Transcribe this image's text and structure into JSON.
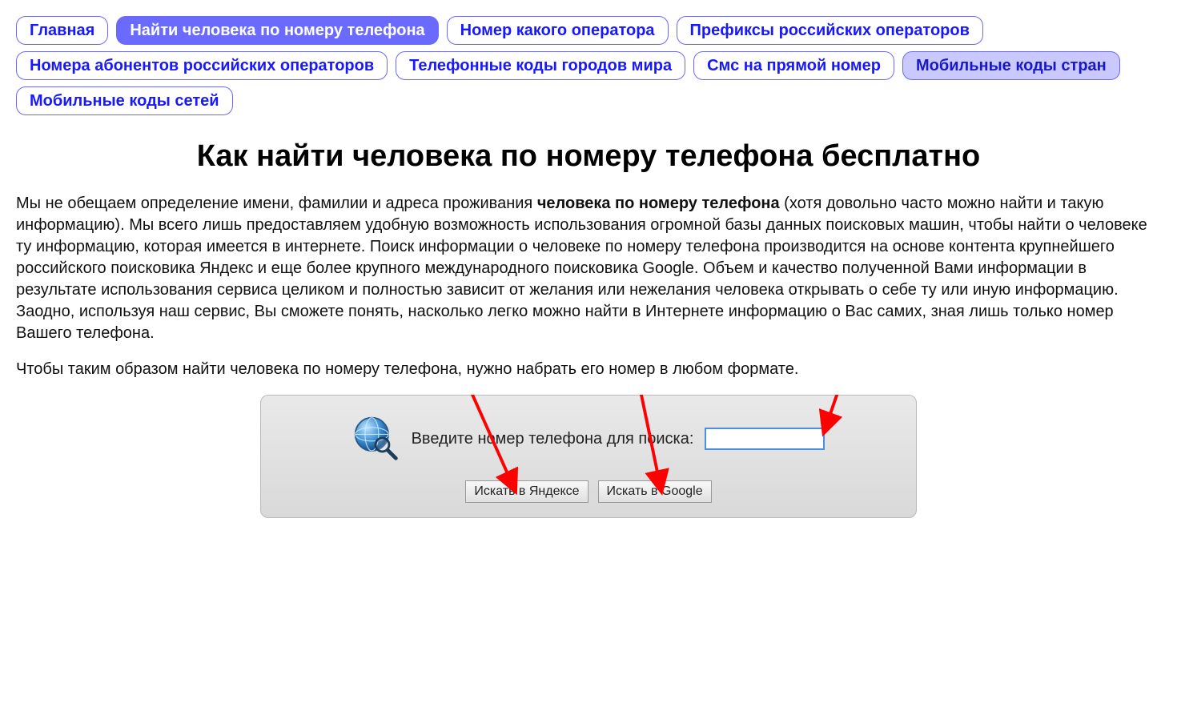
{
  "nav": {
    "items": [
      {
        "label": "Главная",
        "variant": "normal"
      },
      {
        "label": "Найти человека по номеру телефона",
        "variant": "active"
      },
      {
        "label": "Номер какого оператора",
        "variant": "normal"
      },
      {
        "label": "Префиксы российских операторов",
        "variant": "normal"
      },
      {
        "label": "Номера абонентов российских операторов",
        "variant": "normal"
      },
      {
        "label": "Телефонные коды городов мира",
        "variant": "normal"
      },
      {
        "label": "Смс на прямой номер",
        "variant": "normal"
      },
      {
        "label": "Мобильные коды стран",
        "variant": "alt"
      },
      {
        "label": "Мобильные коды сетей",
        "variant": "normal"
      }
    ]
  },
  "page": {
    "title": "Как найти человека по номеру телефона бесплатно",
    "para1_pre": "Мы не обещаем определение имени, фамилии и адреса проживания ",
    "para1_bold": "человека по номеру телефона",
    "para1_post": " (хотя довольно часто можно найти и такую информацию). Мы всего лишь предоставляем удобную возможность использования огромной базы данных поисковых машин, чтобы найти о человеке ту информацию, которая имеется в интернете. Поиск информации о человеке по номеру телефона производится на основе контента крупнейшего российского поисковика Яндекс и еще более крупного международного поисковика Google. Объем и качество полученной Вами информации в результате использования сервиса целиком и полностью зависит от желания или нежелания человека открывать о себе ту или иную информацию. Заодно, используя наш сервис, Вы сможете понять, насколько легко можно найти в Интернете информацию о Вас самих, зная лишь только номер Вашего телефона.",
    "para2": "Чтобы таким образом найти человека по номеру телефона, нужно набрать его номер в любом формате."
  },
  "search": {
    "label": "Введите номер телефона для поиска:",
    "input_value": "",
    "yandex_btn": "Искать в Яндексе",
    "google_btn": "Искать в Google"
  },
  "arrows": {
    "color": "#ff0000"
  }
}
